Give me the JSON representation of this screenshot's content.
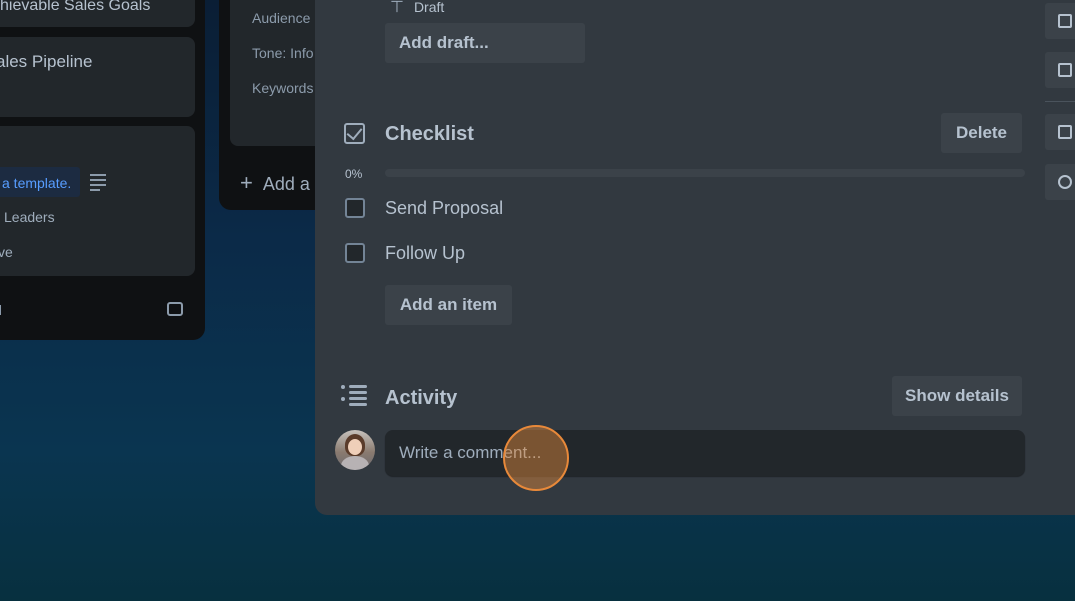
{
  "board": {
    "left_list": {
      "card1_title": "hievable Sales Goals",
      "card2_title": "ales Pipeline",
      "card3": {
        "template_badge": "a template.",
        "lines": [
          "Leaders",
          "ve"
        ]
      }
    },
    "mid_list": {
      "lines": [
        "Audience",
        "Tone: Info",
        "Keywords"
      ],
      "add_label": "Add a"
    }
  },
  "modal": {
    "draft": {
      "label": "Draft",
      "add_button": "Add draft..."
    },
    "checklist": {
      "title": "Checklist",
      "delete_label": "Delete",
      "percent_label": "0%",
      "progress": 0,
      "items": [
        {
          "label": "Send Proposal",
          "checked": false
        },
        {
          "label": "Follow Up",
          "checked": false
        }
      ],
      "add_item_label": "Add an item"
    },
    "activity": {
      "title": "Activity",
      "show_details_label": "Show details",
      "comment_placeholder": "Write a comment..."
    }
  },
  "icons": {
    "checklist": "checklist-icon",
    "activity": "activity-icon",
    "draft": "text-icon",
    "rail": [
      "copy-icon",
      "template-icon",
      "archive-icon",
      "share-icon"
    ]
  },
  "colors": {
    "modal_bg": "#323940",
    "button_bg": "#3b4249",
    "text": "#b6c2cf",
    "badge_text": "#579dff",
    "cursor": "#e8893a"
  }
}
